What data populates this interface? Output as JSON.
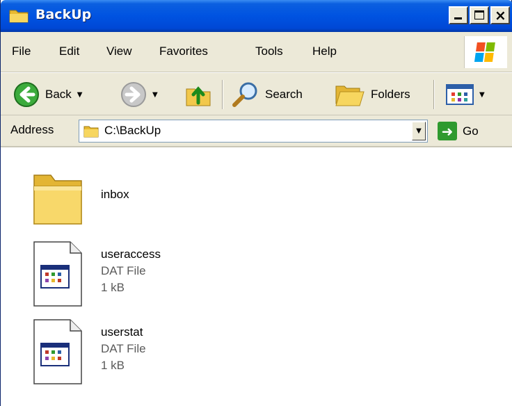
{
  "window": {
    "title": "BackUp"
  },
  "menu": {
    "items": [
      "File",
      "Edit",
      "View",
      "Favorites",
      "Tools",
      "Help"
    ]
  },
  "toolbar": {
    "back_label": "Back",
    "search_label": "Search",
    "folders_label": "Folders"
  },
  "address": {
    "label": "Address",
    "value": "C:\\BackUp",
    "go_label": "Go"
  },
  "files": [
    {
      "name": "inbox",
      "kind": "folder"
    },
    {
      "name": "useraccess",
      "type": "DAT File",
      "size": "1 kB"
    },
    {
      "name": "userstat",
      "type": "DAT File",
      "size": "1 kB"
    }
  ],
  "colors": {
    "titlebar": "#0053e1",
    "chrome": "#ece9d8",
    "go_green": "#2f9a2f"
  }
}
